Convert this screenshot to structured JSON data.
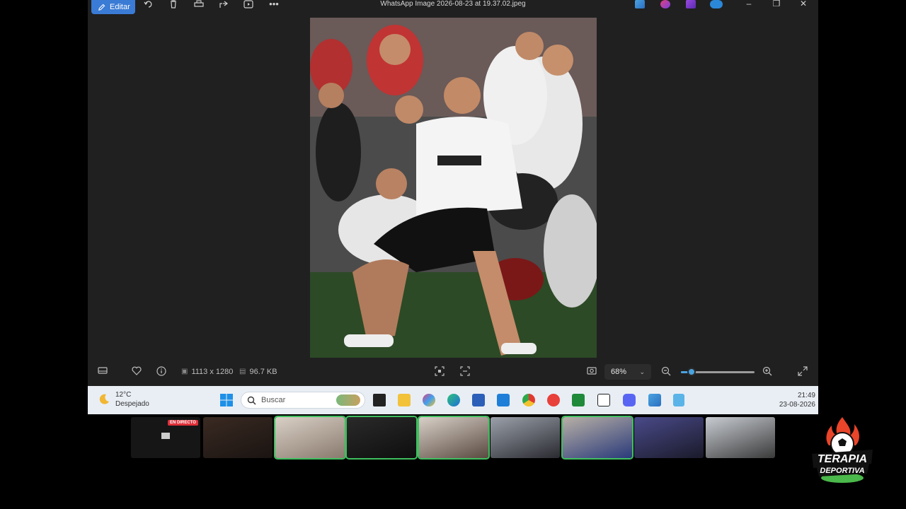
{
  "window": {
    "title": "WhatsApp Image 2026-08-23 at 19.37.02.jpeg",
    "edit_label": "Editar"
  },
  "statusbar": {
    "dimensions": "1113 x 1280",
    "filesize": "96.7 KB",
    "zoom_label": "68%",
    "zoom_level": 0.14
  },
  "taskbar": {
    "weather_temp": "12°C",
    "weather_desc": "Despejado",
    "search_placeholder": "Buscar",
    "time": "21:49",
    "date": "23-08-2026"
  },
  "cams": {
    "live_badge": "EN DIRECTO"
  },
  "logo": {
    "line1": "TERAPIA",
    "line2": "DEPORTIVA"
  },
  "colors": {
    "accent": "#3a7bd5",
    "zoom_accent": "#4aa3e0",
    "live_red": "#e0303a",
    "active_cam": "#3fbf5f"
  }
}
